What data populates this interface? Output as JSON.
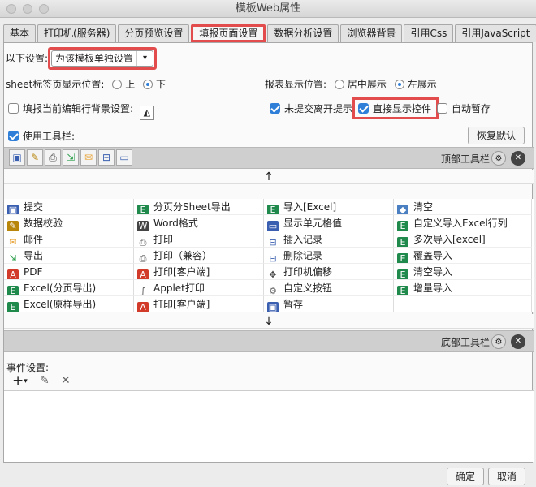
{
  "window": {
    "title": "模板Web属性"
  },
  "tabs": [
    {
      "label": "基本"
    },
    {
      "label": "打印机(服务器)"
    },
    {
      "label": "分页预览设置"
    },
    {
      "label": "填报页面设置"
    },
    {
      "label": "数据分析设置"
    },
    {
      "label": "浏览器背景"
    },
    {
      "label": "引用Css"
    },
    {
      "label": "引用JavaScript"
    }
  ],
  "settings": {
    "scope_label": "以下设置:",
    "scope_value": "为该模板单独设置",
    "sheet_pos_label": "sheet标签页显示位置:",
    "sheet_pos_up": "上",
    "sheet_pos_down": "下",
    "report_pos_label": "报表显示位置:",
    "report_pos_center": "居中展示",
    "report_pos_left": "左展示",
    "fill_bg_label": "填报当前编辑行背景设置:",
    "unsubmitted_label": "未提交离开提示",
    "direct_show_label": "直接显示控件",
    "auto_save_label": "自动暂存",
    "use_toolbar_label": "使用工具栏:",
    "restore_default": "恢复默认"
  },
  "toolbar": {
    "top_label": "顶部工具栏",
    "bottom_label": "底部工具栏",
    "up_arrow": "↑",
    "down_arrow": "↓"
  },
  "toolbar_items": [
    [
      {
        "label": "提交",
        "icon": "submit-icon"
      },
      {
        "label": "分页分Sheet导出",
        "icon": "excel-icon"
      },
      {
        "label": "导入[Excel]",
        "icon": "excel-icon"
      },
      {
        "label": "清空",
        "icon": "eraser-icon"
      }
    ],
    [
      {
        "label": "数据校验",
        "icon": "verify-icon"
      },
      {
        "label": "Word格式",
        "icon": "word-icon"
      },
      {
        "label": "显示单元格值",
        "icon": "cell-icon"
      },
      {
        "label": "自定义导入Excel行列",
        "icon": "excel-icon"
      }
    ],
    [
      {
        "label": "邮件",
        "icon": "mail-icon"
      },
      {
        "label": "打印",
        "icon": "print-icon"
      },
      {
        "label": "插入记录",
        "icon": "insert-icon"
      },
      {
        "label": "多次导入[excel]",
        "icon": "excel-icon"
      }
    ],
    [
      {
        "label": "导出",
        "icon": "export-icon"
      },
      {
        "label": "打印（兼容）",
        "icon": "print-icon"
      },
      {
        "label": "删除记录",
        "icon": "delete-row-icon"
      },
      {
        "label": "覆盖导入",
        "icon": "excel-icon"
      }
    ],
    [
      {
        "label": "PDF",
        "icon": "pdf-icon"
      },
      {
        "label": "打印[客户端]",
        "icon": "pdf-icon"
      },
      {
        "label": "打印机偏移",
        "icon": "move-icon"
      },
      {
        "label": "清空导入",
        "icon": "excel-icon"
      }
    ],
    [
      {
        "label": "Excel(分页导出)",
        "icon": "excel-icon"
      },
      {
        "label": "Applet打印",
        "icon": "applet-icon"
      },
      {
        "label": "自定义按钮",
        "icon": "gear-icon"
      },
      {
        "label": "增量导入",
        "icon": "excel-icon"
      }
    ],
    [
      {
        "label": "Excel(原样导出)",
        "icon": "excel-icon"
      },
      {
        "label": "打印[客户端]",
        "icon": "pdf-icon"
      },
      {
        "label": "暂存",
        "icon": "save-icon"
      },
      {
        "label": "",
        "icon": ""
      }
    ]
  ],
  "events": {
    "label": "事件设置:",
    "add": "+",
    "edit": "✎",
    "remove": "✕"
  },
  "footer": {
    "ok": "确定",
    "cancel": "取消"
  },
  "colors": {
    "highlight": "#e24c4c",
    "accent": "#2f7fd8"
  }
}
